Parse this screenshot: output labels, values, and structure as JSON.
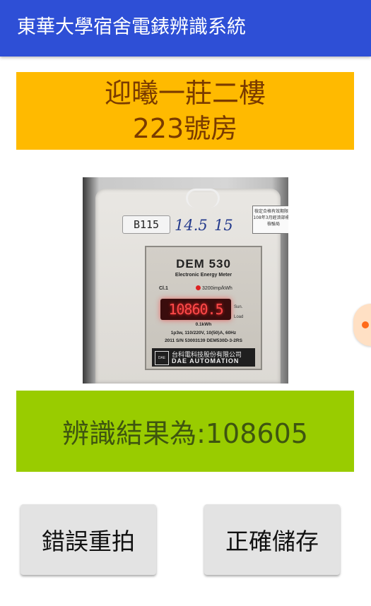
{
  "app_bar": {
    "title": "東華大學宿舍電錶辨識系統"
  },
  "room": {
    "line1": "迎曦一莊二樓",
    "line2": "223號房"
  },
  "photo": {
    "sticker": "B115",
    "handwriting_left": "14.5",
    "handwriting_right": "15",
    "seal_text": "檢定合格有效期限至108年3月經濟部標準檢驗局",
    "model": "DEM 530",
    "subtitle": "Electronic Energy Meter",
    "class": "Cl.1",
    "impulse": "3200imp/kWh",
    "display": "10860.5",
    "side_top": "Sun.",
    "side_bottom": "Load",
    "unit": "0.1kWh",
    "spec1": "1p3w, 110/220V, 10(50)A, 60Hz",
    "spec2": "2011 S/N 53003139  DEM530D-3-2RS",
    "logo": "DAE",
    "brand_cn": "台科電科技股份有限公司",
    "brand_en": "DAE AUTOMATION"
  },
  "result": {
    "text": "辨識結果為:108605"
  },
  "buttons": {
    "retake": "錯誤重拍",
    "save": "正確儲存"
  },
  "colors": {
    "app_bar": "#2e4fd6",
    "room_banner": "#ffba00",
    "result_banner": "#99cc00",
    "button": "#e3e3e3"
  }
}
